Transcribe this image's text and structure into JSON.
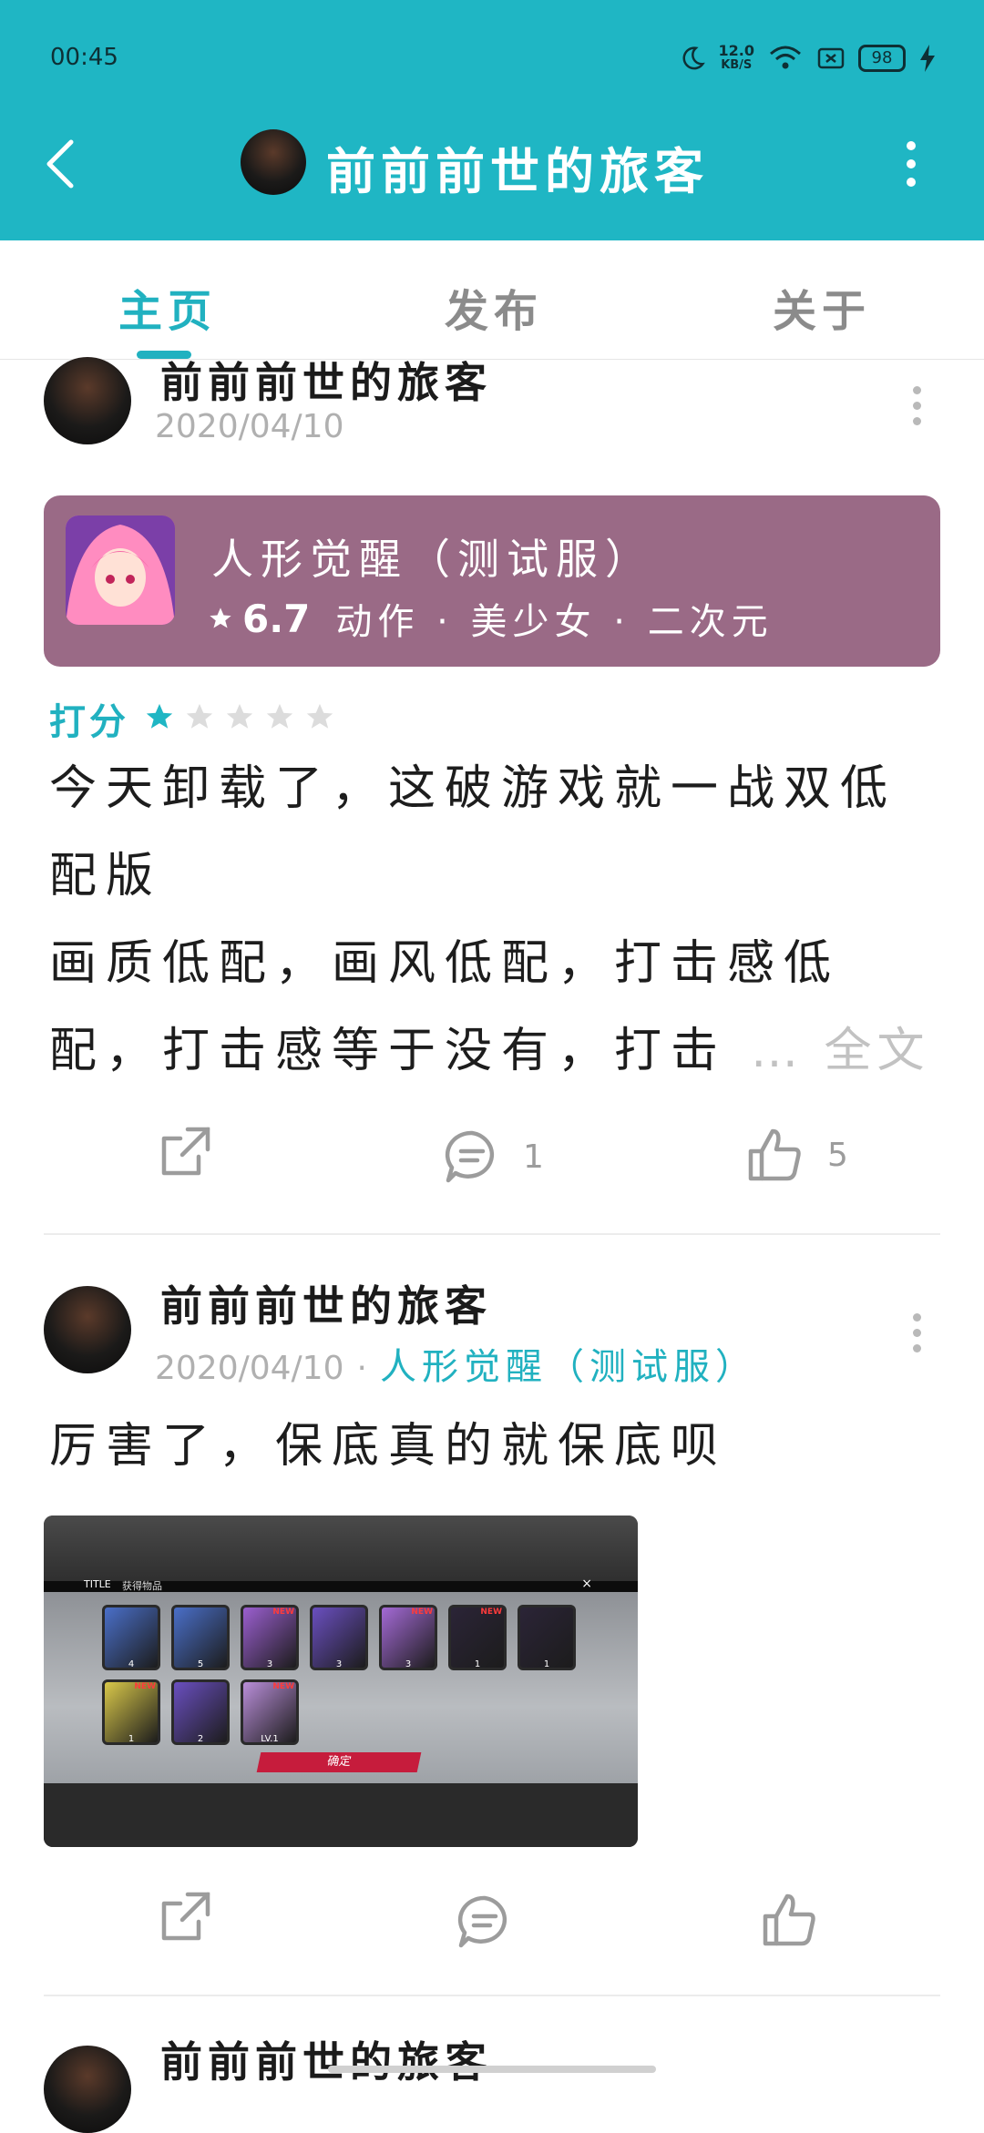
{
  "status_bar": {
    "time": "00:45",
    "network_speed_value": "12.0",
    "network_speed_unit": "KB/S",
    "battery": "98"
  },
  "header": {
    "title": "前前前世的旅客"
  },
  "tabs": [
    {
      "label": "主页",
      "active": true
    },
    {
      "label": "发布",
      "active": false
    },
    {
      "label": "关于",
      "active": false
    }
  ],
  "posts": [
    {
      "author": "前前前世的旅客",
      "date": "2020/04/10",
      "game_card": {
        "title": "人形觉醒（测试服）",
        "rating": "6.7",
        "tags": "动作 · 美少女 · 二次元"
      },
      "score_label": "打分",
      "score_stars": 1,
      "score_max": 5,
      "text_lines": [
        "今天卸载了，这破游戏就一战双低",
        "配版",
        "画质低配，画风低配，打击感低",
        "配，打击感等于没有，打击"
      ],
      "more_label": "… 全文",
      "comments": "1",
      "likes": "5"
    },
    {
      "author": "前前前世的旅客",
      "date": "2020/04/10",
      "game_link": "人形觉醒（测试服）",
      "text": "厉害了，保底真的就保底呗",
      "image": {
        "title_text": "TITLE",
        "subtitle_text": "获得物品",
        "confirm_label": "确定",
        "slot_counts": [
          "4",
          "5",
          "3",
          "3",
          "3",
          "1",
          "1",
          "1",
          "2",
          "LV.1"
        ],
        "new_badge": "NEW"
      }
    },
    {
      "author": "前前前世的旅客"
    }
  ],
  "colors": {
    "accent": "#1fb6c4",
    "card_bg": "#9a6a86",
    "muted": "#b0b0b0"
  }
}
